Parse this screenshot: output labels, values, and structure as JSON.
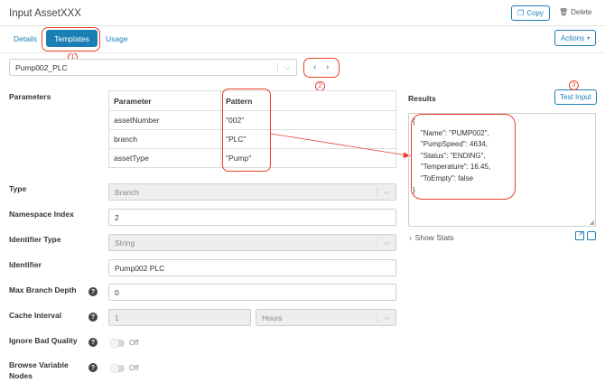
{
  "header": {
    "title": "Input AssetXXX",
    "copy_label": "Copy",
    "delete_label": "Delete"
  },
  "tabs": [
    {
      "label": "Details"
    },
    {
      "label": "Templates"
    },
    {
      "label": "Usage"
    }
  ],
  "actions_label": "Actions",
  "template_select": {
    "value": "Pump002_PLC"
  },
  "pager": {
    "prev": "‹",
    "next": "›"
  },
  "annotations": [
    "1",
    "2",
    "3"
  ],
  "parameters": {
    "label": "Parameters",
    "headers": [
      "Parameter",
      "Pattern"
    ],
    "rows": [
      {
        "parameter": "assetNumber",
        "pattern": "\"002\""
      },
      {
        "parameter": "branch",
        "pattern": "\"PLC\""
      },
      {
        "parameter": "assetType",
        "pattern": "\"Pump\""
      }
    ]
  },
  "fields": {
    "type": {
      "label": "Type",
      "value": "Branch"
    },
    "namespace_index": {
      "label": "Namespace Index",
      "value": "2"
    },
    "identifier_type": {
      "label": "Identifier Type",
      "value": "String"
    },
    "identifier": {
      "label": "Identifier",
      "value": "Pump002 PLC"
    },
    "max_branch_depth": {
      "label": "Max Branch Depth",
      "value": "0"
    },
    "cache_interval": {
      "label": "Cache Interval",
      "value": "1",
      "unit": "Hours"
    },
    "ignore_bad_quality": {
      "label": "Ignore Bad Quality",
      "state": "Off"
    },
    "browse_variable_nodes": {
      "label_line1": "Browse Variable",
      "label_line2": "Nodes",
      "state": "Off"
    }
  },
  "results": {
    "label": "Results",
    "test_input_label": "Test Input",
    "json_lines": [
      "{",
      "    \"Name\": \"PUMP002\",",
      "    \"PumpSpeed\": 4634,",
      "    \"Status\": \"ENDING\",",
      "    \"Temperature\": 16.45,",
      "    \"ToEmpty\": false",
      "}"
    ],
    "show_stats_label": "Show Stats"
  },
  "colors": {
    "accent": "#1b7fb5",
    "annotation": "#e8402a"
  }
}
